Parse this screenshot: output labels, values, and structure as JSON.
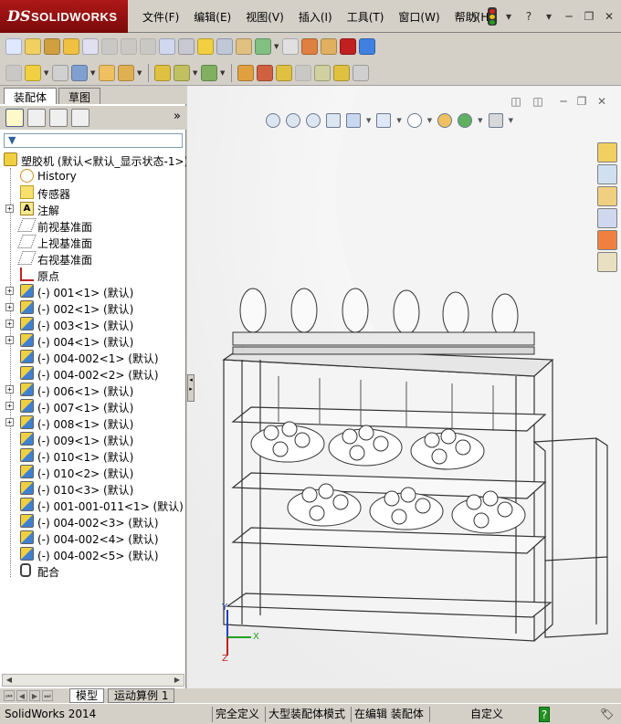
{
  "app": {
    "logo_ds": "DS",
    "logo_name": "SOLIDWORKS"
  },
  "menu": [
    "文件(F)",
    "编辑(E)",
    "视图(V)",
    "插入(I)",
    "工具(T)",
    "窗口(W)",
    "帮助(H)"
  ],
  "left_panel": {
    "tabs": [
      "装配体",
      "草图"
    ],
    "active_tab": "装配体",
    "filter_icon": "funnel-icon",
    "tree": [
      {
        "label": "塑胶机  (默认<默认_显示状态-1>)",
        "icon": "assembly-icon",
        "level": 0,
        "expand": false
      },
      {
        "label": "History",
        "icon": "history-icon",
        "level": 1,
        "expand": false
      },
      {
        "label": "传感器",
        "icon": "sensor-icon",
        "level": 1,
        "expand": false
      },
      {
        "label": "注解",
        "icon": "annotation-icon",
        "level": 1,
        "expand": true
      },
      {
        "label": "前视基准面",
        "icon": "plane-icon",
        "level": 1,
        "expand": false
      },
      {
        "label": "上视基准面",
        "icon": "plane-icon",
        "level": 1,
        "expand": false
      },
      {
        "label": "右视基准面",
        "icon": "plane-icon",
        "level": 1,
        "expand": false
      },
      {
        "label": "原点",
        "icon": "origin-icon",
        "level": 1,
        "expand": false
      },
      {
        "label": "(-) 001<1> (默认)",
        "icon": "part-icon",
        "level": 1,
        "expand": true
      },
      {
        "label": "(-) 002<1> (默认)",
        "icon": "part-icon",
        "level": 1,
        "expand": true
      },
      {
        "label": "(-) 003<1> (默认)",
        "icon": "part-icon",
        "level": 1,
        "expand": true
      },
      {
        "label": "(-) 004<1> (默认)",
        "icon": "part-icon",
        "level": 1,
        "expand": true
      },
      {
        "label": "(-) 004-002<1> (默认)",
        "icon": "part-icon",
        "level": 1,
        "expand": false
      },
      {
        "label": "(-) 004-002<2> (默认)",
        "icon": "part-icon",
        "level": 1,
        "expand": false
      },
      {
        "label": "(-) 006<1> (默认)",
        "icon": "part-icon",
        "level": 1,
        "expand": true
      },
      {
        "label": "(-) 007<1> (默认)",
        "icon": "part-icon",
        "level": 1,
        "expand": true
      },
      {
        "label": "(-) 008<1> (默认)",
        "icon": "part-icon",
        "level": 1,
        "expand": true
      },
      {
        "label": "(-) 009<1> (默认)",
        "icon": "part-icon",
        "level": 1,
        "expand": false
      },
      {
        "label": "(-) 010<1> (默认)",
        "icon": "part-icon",
        "level": 1,
        "expand": false
      },
      {
        "label": "(-) 010<2> (默认)",
        "icon": "part-icon",
        "level": 1,
        "expand": false
      },
      {
        "label": "(-) 010<3> (默认)",
        "icon": "part-icon",
        "level": 1,
        "expand": false
      },
      {
        "label": "(-) 001-001-011<1> (默认)",
        "icon": "part-icon",
        "level": 1,
        "expand": false
      },
      {
        "label": "(-) 004-002<3> (默认)",
        "icon": "part-icon",
        "level": 1,
        "expand": false
      },
      {
        "label": "(-) 004-002<4> (默认)",
        "icon": "part-icon",
        "level": 1,
        "expand": false
      },
      {
        "label": "(-) 004-002<5> (默认)",
        "icon": "part-icon",
        "level": 1,
        "expand": false
      },
      {
        "label": "配合",
        "icon": "mates-icon",
        "level": 1,
        "expand": false
      }
    ]
  },
  "bottom_tabs": [
    "模型",
    "运动算例 1"
  ],
  "status_bar": {
    "app_version": "SolidWorks 2014",
    "definition": "完全定义",
    "mode": "大型装配体模式",
    "editing": "在编辑 装配体",
    "units": "自定义",
    "help": "?"
  },
  "triad": {
    "x": "X",
    "y": "Y",
    "z": "Z"
  },
  "colors": {
    "logo_red": "#a01010",
    "panel_bg": "#d4d0c8",
    "accent_blue": "#3060a0"
  }
}
